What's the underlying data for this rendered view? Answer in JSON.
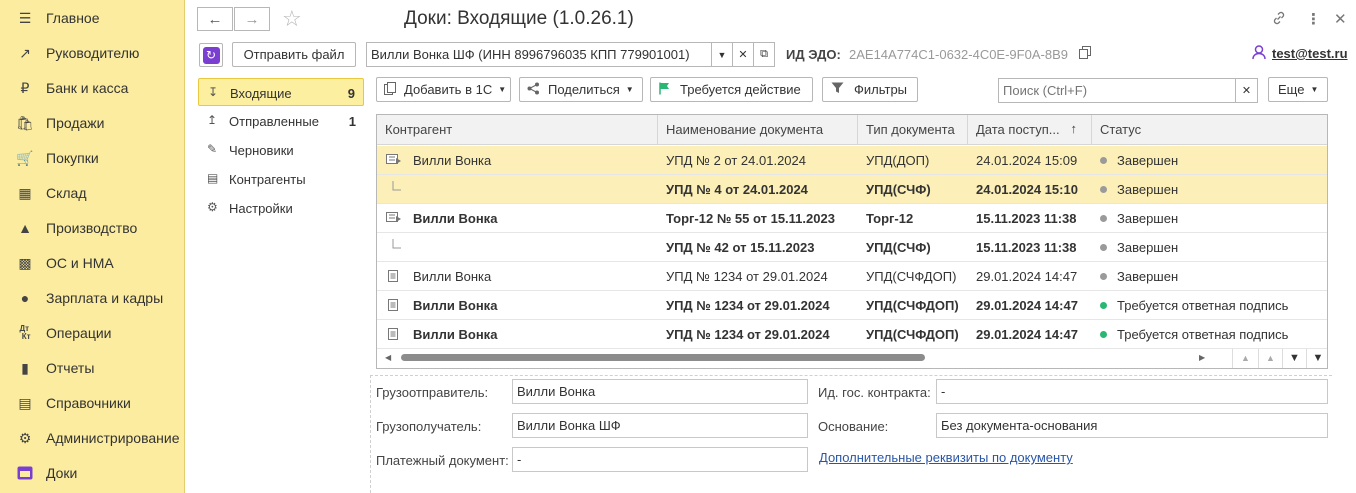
{
  "nav": {
    "items": [
      {
        "label": "Главное",
        "icon": "menu-icon"
      },
      {
        "label": "Руководителю",
        "icon": "trend-icon"
      },
      {
        "label": "Банк и касса",
        "icon": "ruble-icon"
      },
      {
        "label": "Продажи",
        "icon": "bag-icon"
      },
      {
        "label": "Покупки",
        "icon": "cart-icon"
      },
      {
        "label": "Склад",
        "icon": "warehouse-icon"
      },
      {
        "label": "Производство",
        "icon": "factory-icon"
      },
      {
        "label": "ОС и НМА",
        "icon": "truck-icon"
      },
      {
        "label": "Зарплата и кадры",
        "icon": "person-icon"
      },
      {
        "label": "Операции",
        "icon": "dt-kt-icon"
      },
      {
        "label": "Отчеты",
        "icon": "bar-chart-icon"
      },
      {
        "label": "Справочники",
        "icon": "book-icon"
      },
      {
        "label": "Администрирование",
        "icon": "gear-icon"
      },
      {
        "label": "Доки",
        "icon": "doki-icon"
      }
    ]
  },
  "header": {
    "title": "Доки: Входящие (1.0.26.1)"
  },
  "toolbar": {
    "send_file": "Отправить файл",
    "org_value": "Вилли Вонка ШФ (ИНН 8996796035 КПП 779901001)",
    "edo_label": "ИД ЭДО:",
    "edo_value": "2AE14A774C1-0632-4C0E-9F0A-8B9",
    "user": "test@test.ru"
  },
  "subnav": {
    "items": [
      {
        "label": "Входящие",
        "count": "9"
      },
      {
        "label": "Отправленные",
        "count": "1"
      },
      {
        "label": "Черновики",
        "count": ""
      },
      {
        "label": "Контрагенты",
        "count": ""
      },
      {
        "label": "Настройки",
        "count": ""
      }
    ]
  },
  "actions": {
    "add_1c": "Добавить в 1С",
    "share": "Поделиться",
    "action_required": "Требуется действие",
    "filters": "Фильтры",
    "search_placeholder": "Поиск (Ctrl+F)",
    "more": "Еще"
  },
  "table": {
    "headers": [
      "Контрагент",
      "Наименование документа",
      "Тип документа",
      "Дата поступ...",
      "Статус"
    ],
    "rows": [
      {
        "contractor": "Вилли Вонка",
        "doc": "УПД № 2 от 24.01.2024",
        "type": "УПД(ДОП)",
        "date": "24.01.2024 15:09",
        "status": "Завершен",
        "status_color": "#9a9a9a"
      },
      {
        "contractor": "",
        "doc": "УПД № 4 от 24.01.2024",
        "type": "УПД(СЧФ)",
        "date": "24.01.2024 15:10",
        "status": "Завершен",
        "status_color": "#9a9a9a"
      },
      {
        "contractor": "Вилли Вонка",
        "doc": "Торг-12 № 55 от 15.11.2023",
        "type": "Торг-12",
        "date": "15.11.2023 11:38",
        "status": "Завершен",
        "status_color": "#9a9a9a"
      },
      {
        "contractor": "",
        "doc": "УПД № 42 от 15.11.2023",
        "type": "УПД(СЧФ)",
        "date": "15.11.2023 11:38",
        "status": "Завершен",
        "status_color": "#9a9a9a"
      },
      {
        "contractor": "Вилли Вонка",
        "doc": "УПД № 1234 от 29.01.2024",
        "type": "УПД(СЧФДОП)",
        "date": "29.01.2024 14:47",
        "status": "Завершен",
        "status_color": "#9a9a9a"
      },
      {
        "contractor": "Вилли Вонка",
        "doc": "УПД № 1234 от 29.01.2024",
        "type": "УПД(СЧФДОП)",
        "date": "29.01.2024 14:47",
        "status": "Требуется ответная подпись",
        "status_color": "#2ab673"
      },
      {
        "contractor": "Вилли Вонка",
        "doc": "УПД № 1234 от 29.01.2024",
        "type": "УПД(СЧФДОП)",
        "date": "29.01.2024 14:47",
        "status": "Требуется ответная подпись",
        "status_color": "#2ab673"
      }
    ]
  },
  "details": {
    "shipper_label": "Грузоотправитель:",
    "shipper_value": "Вилли Вонка",
    "consignee_label": "Грузополучатель:",
    "consignee_value": "Вилли Вонка ШФ",
    "payment_label": "Платежный документ:",
    "payment_value": "-",
    "contract_label": "Ид. гос. контракта:",
    "contract_value": "-",
    "basis_label": "Основание:",
    "basis_value": "Без документа-основания",
    "extra_link": "Дополнительные реквизиты по документу"
  }
}
